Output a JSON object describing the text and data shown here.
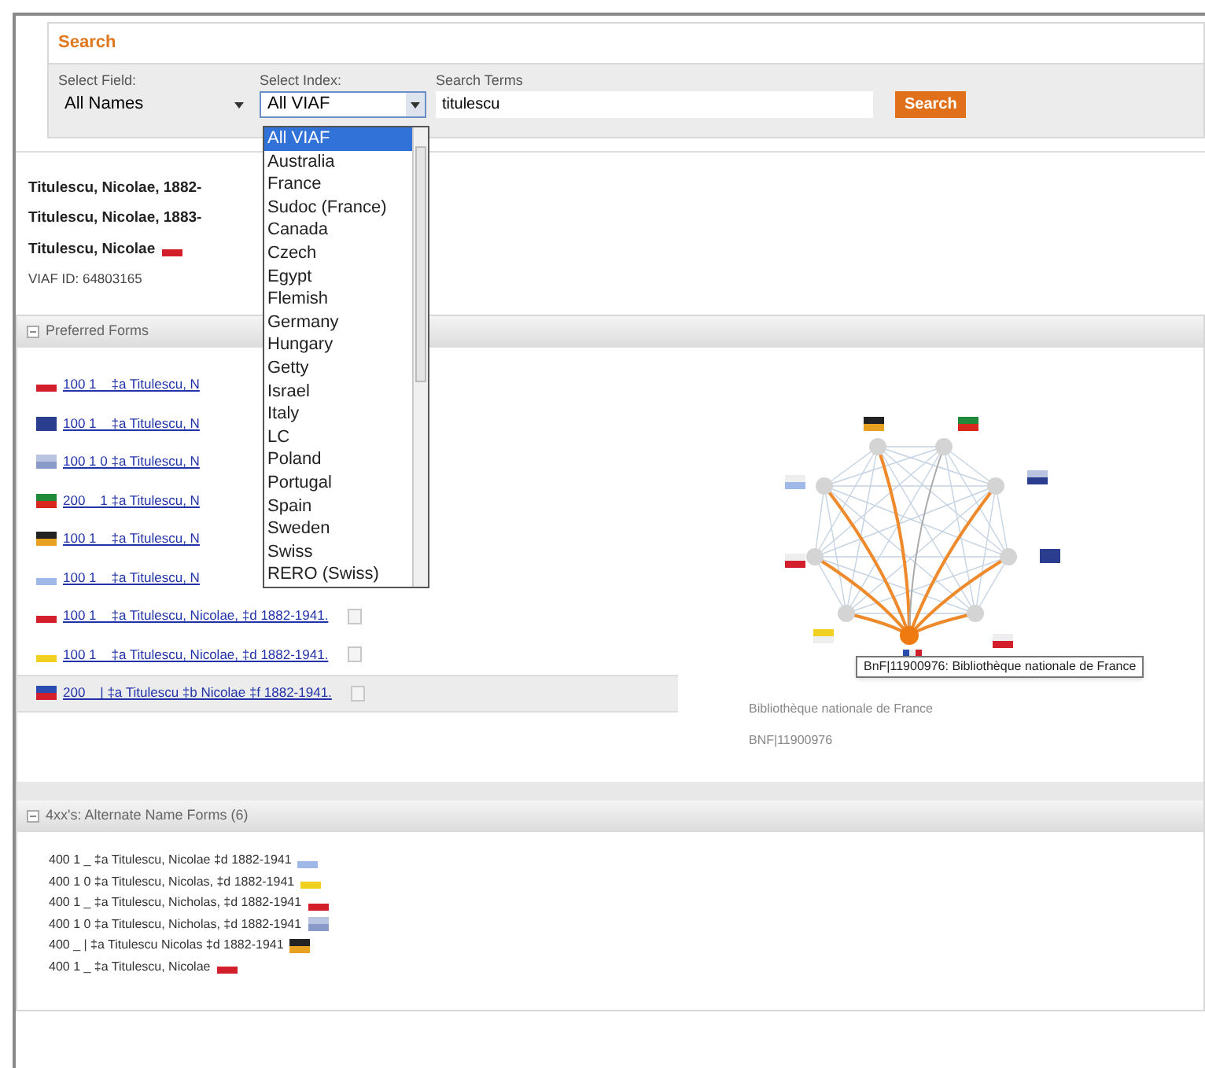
{
  "search": {
    "title": "Search",
    "field_label": "Select Field:",
    "field_value": "All Names",
    "index_label": "Select Index:",
    "index_value": "All VIAF",
    "terms_label": "Search Terms",
    "terms_value": "titulescu",
    "button": "Search",
    "index_options": [
      {
        "label": "All VIAF",
        "selected": true
      },
      {
        "label": "Australia",
        "selected": false
      },
      {
        "label": "France",
        "selected": false
      },
      {
        "label": "Sudoc (France)",
        "selected": false
      },
      {
        "label": "Canada",
        "selected": false
      },
      {
        "label": "Czech",
        "selected": false
      },
      {
        "label": "Egypt",
        "selected": false
      },
      {
        "label": "Flemish",
        "selected": false
      },
      {
        "label": "Germany",
        "selected": false
      },
      {
        "label": "Hungary",
        "selected": false
      },
      {
        "label": "Getty",
        "selected": false
      },
      {
        "label": "Israel",
        "selected": false
      },
      {
        "label": "Italy",
        "selected": false
      },
      {
        "label": "LC",
        "selected": false
      },
      {
        "label": "Poland",
        "selected": false
      },
      {
        "label": "Portugal",
        "selected": false
      },
      {
        "label": "Spain",
        "selected": false
      },
      {
        "label": "Sweden",
        "selected": false
      },
      {
        "label": "Swiss",
        "selected": false
      },
      {
        "label": "RERO (Swiss)",
        "selected": false
      }
    ]
  },
  "headings": [
    {
      "text": "Titulescu, Nicolae, 1882-",
      "flag": false
    },
    {
      "text": "Titulescu, Nicolae, 1883-",
      "flag": false
    },
    {
      "text": "Titulescu, Nicolae",
      "flag": true
    }
  ],
  "viaf_id": "VIAF ID: 64803165",
  "preferred_forms": {
    "title": "Preferred Forms",
    "rows": [
      {
        "text": "100 1 _ ‡a Titulescu, N",
        "selected": false
      },
      {
        "text": "100 1 _ ‡a Titulescu, N",
        "selected": false
      },
      {
        "text": "100 1 0 ‡a Titulescu, N",
        "selected": false
      },
      {
        "text": "200 _ 1 ‡a Titulescu, N",
        "selected": false
      },
      {
        "text": "100 1 _ ‡a Titulescu, N",
        "selected": false
      },
      {
        "text": "100 1 _ ‡a Titulescu, N",
        "selected": false
      },
      {
        "text": "100 1 _ ‡a Titulescu, Nicolae, ‡d 1882-1941.",
        "selected": false
      },
      {
        "text": "100 1 _ ‡a Titulescu, Nicolae, ‡d 1882-1941.",
        "selected": false
      },
      {
        "text": "200 _ | ‡a Titulescu ‡b Nicolae ‡f 1882-1941.",
        "selected": true
      }
    ]
  },
  "graph": {
    "tooltip": "BnF|11900976: Bibliothèque nationale de France",
    "source_name": "Bibliothèque nationale de France",
    "source_id": "BNF|11900976"
  },
  "alternate_forms": {
    "title": "4xx's: Alternate Name Forms (6)",
    "rows": [
      "400 1 _ ‡a Titulescu, Nicolae ‡d 1882-1941",
      "400 1 0 ‡a Titulescu, Nicolas, ‡d 1882-1941",
      "400 1 _ ‡a Titulescu, Nicholas, ‡d 1882-1941",
      "400 1 0 ‡a Titulescu, Nicholas, ‡d 1882-1941",
      "400 _ | ‡a Titulescu Nicolas ‡d 1882-1941",
      "400 1 _ ‡a Titulescu, Nicolae"
    ]
  }
}
